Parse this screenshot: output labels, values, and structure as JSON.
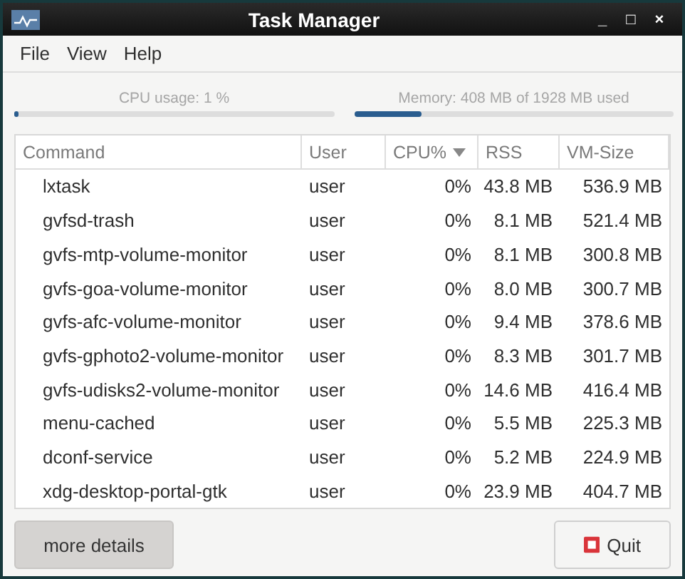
{
  "window": {
    "title": "Task Manager",
    "controls": [
      "_",
      "□",
      "×"
    ]
  },
  "menu": [
    "File",
    "View",
    "Help"
  ],
  "meters": [
    {
      "label": "CPU usage: 1 %",
      "level": 0.01
    },
    {
      "label": "Memory: 408 MB of 1928 MB used",
      "level": 0.21
    }
  ],
  "table": {
    "columns": [
      {
        "label": "Command",
        "sorted": false
      },
      {
        "label": "User",
        "sorted": false
      },
      {
        "label": "CPU%",
        "sorted": true
      },
      {
        "label": "RSS",
        "sorted": false
      },
      {
        "label": "VM-Size",
        "sorted": false
      }
    ],
    "rows": [
      [
        "lxtask",
        "user",
        "0%",
        "43.8 MB",
        "536.9 MB"
      ],
      [
        "gvfsd-trash",
        "user",
        "0%",
        "8.1 MB",
        "521.4 MB"
      ],
      [
        "gvfs-mtp-volume-monitor",
        "user",
        "0%",
        "8.1 MB",
        "300.8 MB"
      ],
      [
        "gvfs-goa-volume-monitor",
        "user",
        "0%",
        "8.0 MB",
        "300.7 MB"
      ],
      [
        "gvfs-afc-volume-monitor",
        "user",
        "0%",
        "9.4 MB",
        "378.6 MB"
      ],
      [
        "gvfs-gphoto2-volume-monitor",
        "user",
        "0%",
        "8.3 MB",
        "301.7 MB"
      ],
      [
        "gvfs-udisks2-volume-monitor",
        "user",
        "0%",
        "14.6 MB",
        "416.4 MB"
      ],
      [
        "menu-cached",
        "user",
        "0%",
        "5.5 MB",
        "225.3 MB"
      ],
      [
        "dconf-service",
        "user",
        "0%",
        "5.2 MB",
        "224.9 MB"
      ],
      [
        "xdg-desktop-portal-gtk",
        "user",
        "0%",
        "23.9 MB",
        "404.7 MB"
      ]
    ]
  },
  "buttons": [
    {
      "label": "more details",
      "kind": "plain"
    },
    {
      "label": "Quit",
      "kind": "quit"
    }
  ]
}
